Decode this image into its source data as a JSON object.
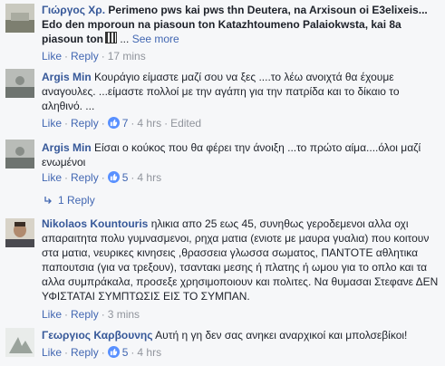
{
  "comments": [
    {
      "author": "Γιώργος Χρ.",
      "text": "Perimeno pws kai pws thn Deutera, na Arxisoun oi E3elixeis... Edo den mporoun na piasoun ton Katazhtoumeno Palaiokwsta, kai 8a piasoun ton",
      "see_more": "See more",
      "like_label": "Like",
      "reply_label": "Reply",
      "time": "17 mins"
    },
    {
      "author": "Argis Min",
      "text": "Κουράγιο είμαστε μαζί σου να ξες ....το λέω ανοιχτά θα έχουμε αναγουλες. ...είμαστε πολλοί με την αγάπη για την πατρίδα και το δίκαιο το αληθινό. ...",
      "like_label": "Like",
      "reply_label": "Reply",
      "like_count": "7",
      "time": "4 hrs",
      "edited": "Edited"
    },
    {
      "author": "Argis Min",
      "text": "Είσαι ο κούκος που θα φέρει την άνοιξη ...το πρώτο αίμα....όλοι μαζί ενωμένοι",
      "like_label": "Like",
      "reply_label": "Reply",
      "like_count": "5",
      "time": "4 hrs",
      "replies_label": "1 Reply"
    },
    {
      "author": "Nikolaos Kountouris",
      "text": "ηλικια απο 25 εως 45, συνηθως γεροδεμενοι αλλα οχι απαραιτητα πολυ γυμνασμενοι, ρηχα ματια (ενιοτε με μαυρα γυαλια) που κοιτουν στα ματια, νευρικες κινησεις ,θρασσεια γλωσσα σωματος, ΠΑΝΤΟΤΕ αθλητικα παπουτσια (για να τρεξουν), τσαντακι μεσης ή πλατης ή ωμου για το οπλο και τα αλλα συμπράκαλα, προσεξε χρησιμοποιουν και πολιτες. Να θυμασαι Στεφανε ΔΕΝ ΥΦΙΣΤΑΤΑΙ ΣΥΜΠΤΩΣΙΣ ΕΙΣ ΤΟ ΣΥΜΠΑΝ.",
      "like_label": "Like",
      "reply_label": "Reply",
      "time": "3 mins"
    },
    {
      "author": "Γεωργιος Καρβουνης",
      "text": "Αυτή η γη δεν σας ανηκει αναρχικοί και μπολσεβίκοι!",
      "like_label": "Like",
      "reply_label": "Reply",
      "like_count": "5",
      "time": "4 hrs"
    }
  ],
  "separator": "·",
  "colors": {
    "link": "#4267b2",
    "name": "#365899",
    "meta": "#90949c",
    "like_badge": "#5890ff"
  }
}
